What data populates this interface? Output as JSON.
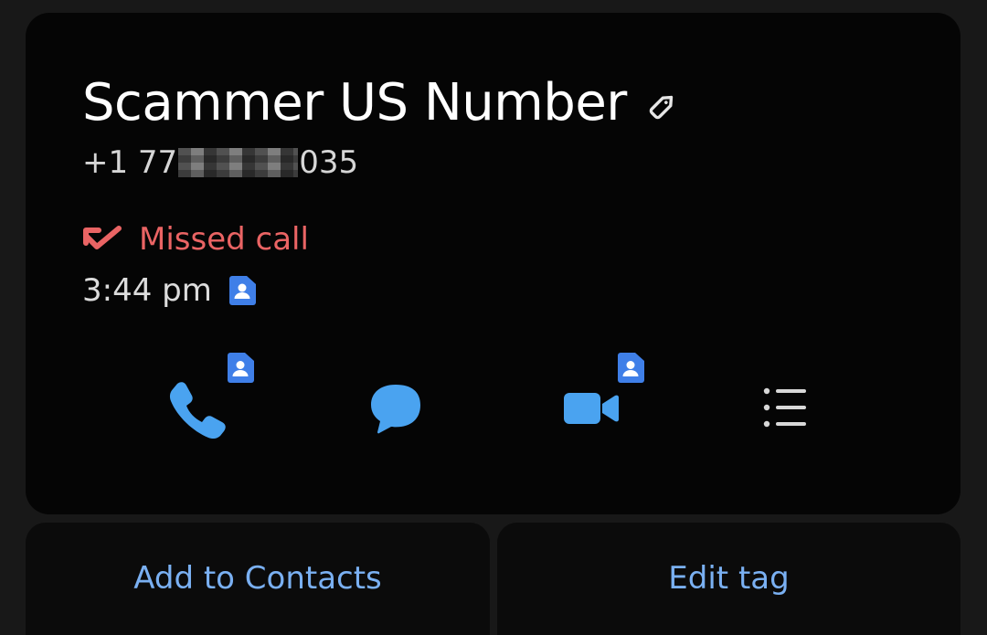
{
  "contact": {
    "name": "Scammer US Number",
    "number_prefix": "+1 77",
    "number_suffix": "035"
  },
  "call": {
    "status": "Missed call",
    "time": "3:44 pm"
  },
  "actions": {
    "call_icon": "phone-icon",
    "message_icon": "chat-bubble-icon",
    "video_icon": "video-camera-icon",
    "details_icon": "list-icon"
  },
  "buttons": {
    "add_to_contacts": "Add to Contacts",
    "edit_tag": "Edit tag"
  },
  "colors": {
    "accent_blue": "#4aa3f0",
    "badge_blue": "#3f7fe8",
    "missed_red": "#ea6464",
    "link_blue": "#7ab0f2"
  }
}
